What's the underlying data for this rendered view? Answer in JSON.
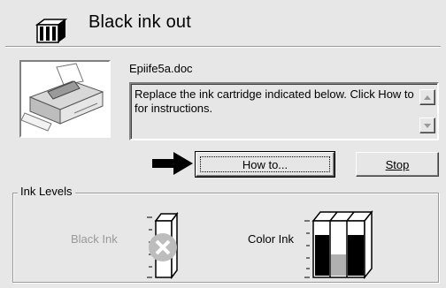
{
  "header": {
    "title": "Black ink out",
    "icon": "ink-cartridge-icon"
  },
  "document_name": "Epiife5a.doc",
  "message": "Replace the ink cartridge indicated below. Click How to for instructions.",
  "buttons": {
    "how_to": "How to...",
    "stop": "Stop"
  },
  "ink_levels": {
    "group_label": "Ink Levels",
    "black_label": "Black Ink",
    "black_status": "empty",
    "color_label": "Color Ink",
    "color_status": "low"
  },
  "colors": {
    "background": "#e7e7e7",
    "disabled_text": "#999999",
    "x_mark": "#bdbdbd"
  }
}
